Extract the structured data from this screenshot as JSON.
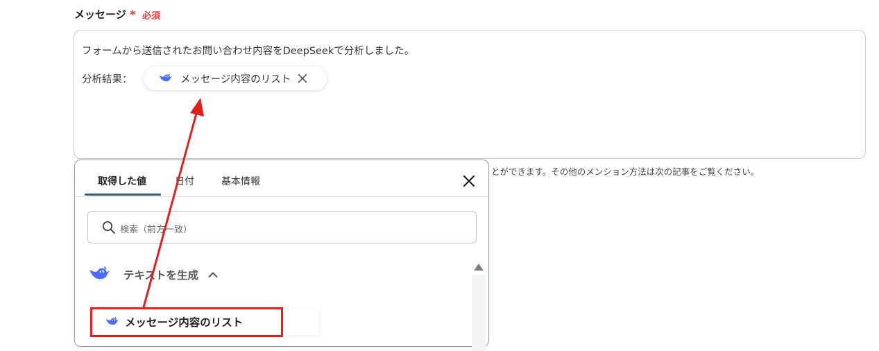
{
  "field": {
    "label": "メッセージ",
    "required_star": "*",
    "required_text": "必須"
  },
  "message": {
    "line1": "フォームから送信されたお問い合わせ内容をDeepSeekで分析しました。",
    "line2_prefix": "分析結果：",
    "chip_label": "メッセージ内容のリスト"
  },
  "help_text": "とができます。その他のメンション方法は次の記事をご覧ください。",
  "popup": {
    "tabs": [
      {
        "label": "取得した値",
        "active": true
      },
      {
        "label": "日付",
        "active": false
      },
      {
        "label": "基本情報",
        "active": false
      }
    ],
    "search_placeholder": "検索（前方一致）",
    "group_label": "テキストを生成",
    "item_label": "メッセージ内容のリスト"
  },
  "colors": {
    "accent_tab": "#2f5f74",
    "required": "#e8403f",
    "deepseek": "#4d6bfe",
    "highlight": "#e0201b"
  },
  "icons": [
    "deepseek-icon",
    "close-icon",
    "search-icon",
    "chevron-up-icon",
    "scroll-up-icon"
  ]
}
